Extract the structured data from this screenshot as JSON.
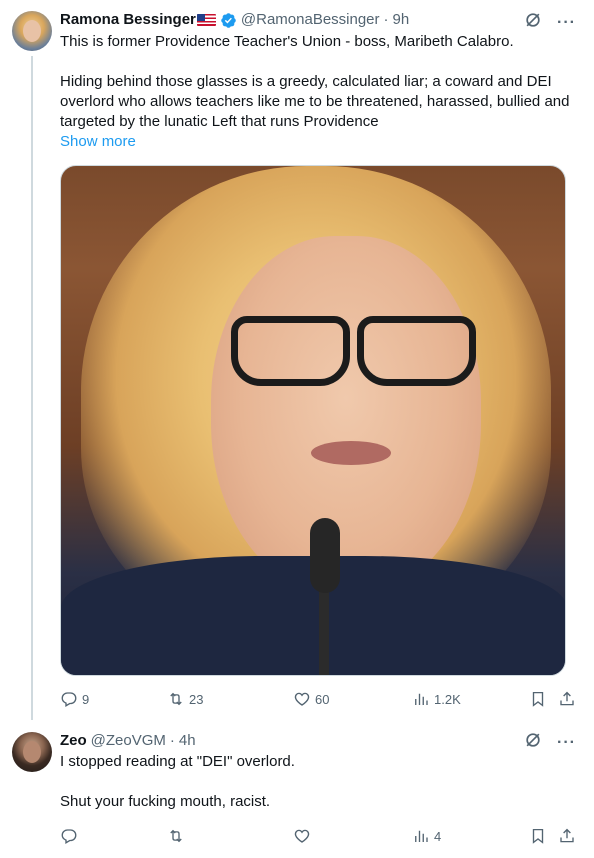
{
  "tweets": [
    {
      "author_name": "Ramona Bessinger",
      "flag": "🇺🇸",
      "verified": true,
      "handle": "@RamonaBessinger",
      "time": "9h",
      "paragraphs": [
        "This is former Providence Teacher's Union - boss, Maribeth Calabro.",
        "Hiding behind those glasses is a greedy, calculated liar; a coward and DEI overlord who allows teachers like me to be threatened, harassed, bullied and targeted by the lunatic Left that runs Providence"
      ],
      "show_more": "Show more",
      "has_media": true,
      "counts": {
        "replies": "9",
        "retweets": "23",
        "likes": "60",
        "views": "1.2K"
      }
    },
    {
      "author_name": "Zeo",
      "handle": "@ZeoVGM",
      "time": "4h",
      "paragraphs": [
        "I stopped reading at \"DEI\" overlord.",
        "Shut your fucking mouth, racist."
      ],
      "counts": {
        "replies": "",
        "retweets": "",
        "likes": "",
        "views": "4"
      }
    }
  ],
  "separator": "·",
  "icons": {
    "reply": "reply-icon",
    "retweet": "retweet-icon",
    "like": "heart-icon",
    "views": "views-icon",
    "bookmark": "bookmark-icon",
    "share": "share-icon",
    "grok": "grok-icon",
    "more": "more-icon",
    "verified": "verified-badge-icon"
  },
  "colors": {
    "text": "#0f1419",
    "muted": "#536471",
    "link": "#1d9bf0",
    "verified": "#1d9bf0",
    "border": "#cfd9de"
  }
}
